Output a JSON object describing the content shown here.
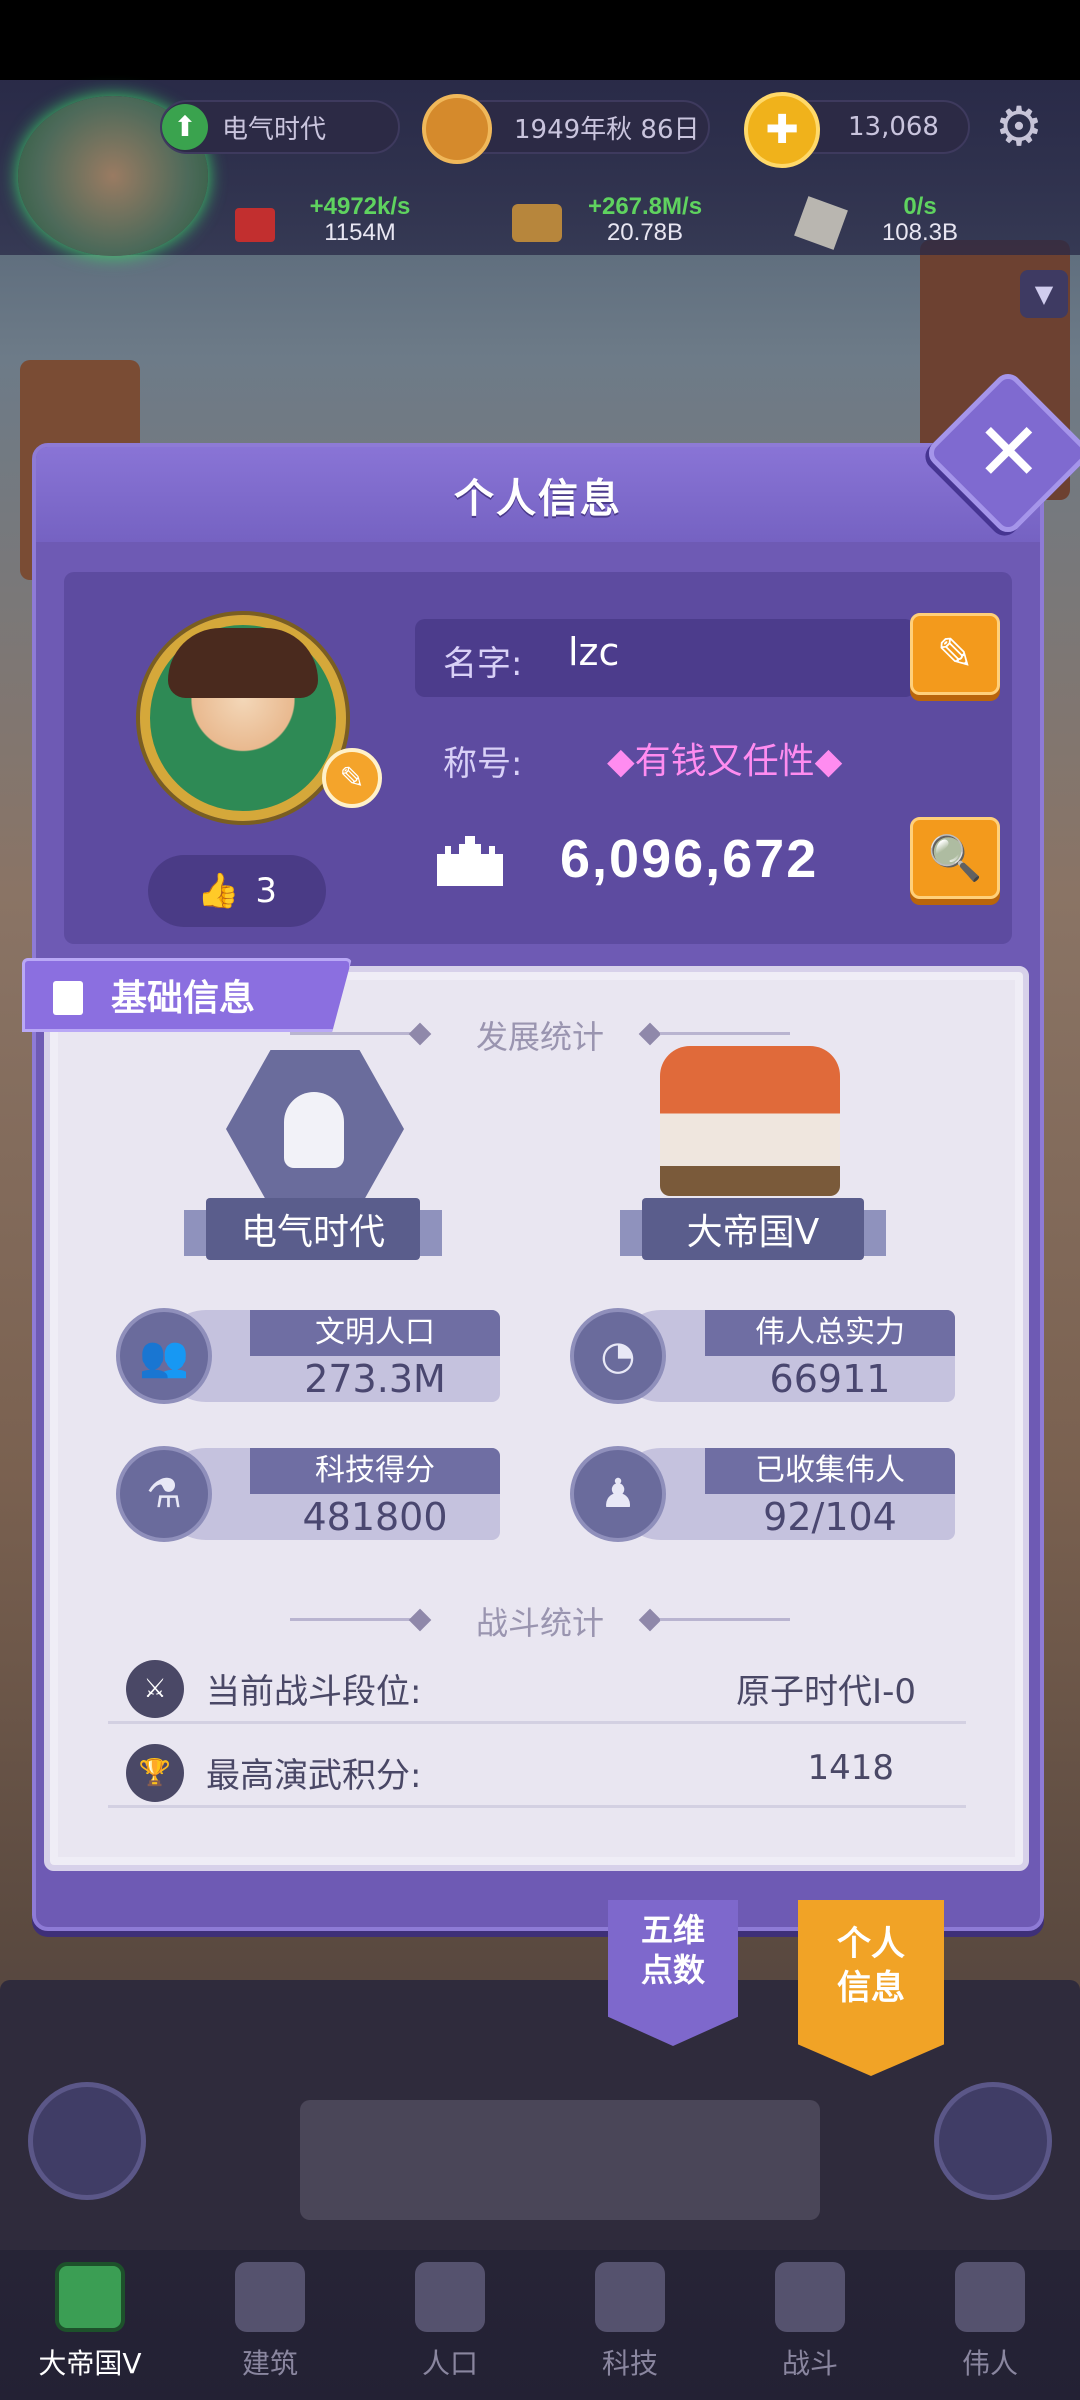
{
  "hud": {
    "era": "电气时代",
    "date": "1949年秋 86日",
    "gold": "13,068",
    "resources": [
      {
        "rate": "+4972k/s",
        "amount": "1154M"
      },
      {
        "rate": "+267.8M/s",
        "amount": "20.78B"
      },
      {
        "rate": "0/s",
        "amount": "108.3B"
      }
    ]
  },
  "modal": {
    "title": "个人信息",
    "name_label": "名字:",
    "name_value": "lzc",
    "title_label": "称号:",
    "title_value": "◆有钱又任性◆",
    "power": "6,096,672",
    "likes": "3"
  },
  "basic_info": {
    "tab_label": "基础信息",
    "dev_title": "发展统计",
    "era_badge": "电气时代",
    "empire_badge": "大帝国V",
    "stats": [
      {
        "label": "文明人口",
        "value": "273.3M",
        "icon": "people-icon"
      },
      {
        "label": "伟人总实力",
        "value": "66911",
        "icon": "power-icon"
      },
      {
        "label": "科技得分",
        "value": "481800",
        "icon": "flask-icon"
      },
      {
        "label": "已收集伟人",
        "value": "92/104",
        "icon": "person-icon"
      }
    ],
    "battle_title": "战斗统计",
    "battle_rank_label": "当前战斗段位:",
    "battle_rank_value": "原子时代Ⅰ-0",
    "battle_max_label": "最高演武积分:",
    "battle_max_value": "1418"
  },
  "side_tabs": {
    "five": "五维\n点数",
    "personal": "个人\n信息"
  },
  "nav": [
    "大帝国V",
    "建筑",
    "人口",
    "科技",
    "战斗",
    "伟人"
  ],
  "colors": {
    "modal": "#6e5ab4",
    "accent_orange": "#f39a1c",
    "title_pink": "#ff8cf0",
    "rate_green": "#5fd35f"
  }
}
